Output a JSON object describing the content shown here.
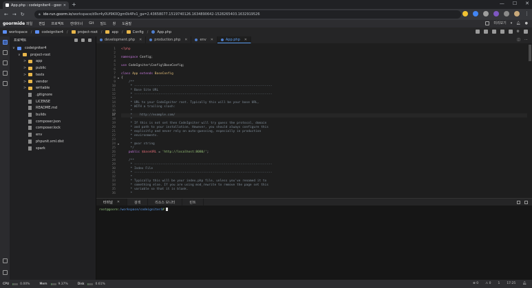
{
  "browser": {
    "tab_title": "App.php : codeigniter4 - goor...",
    "new_tab": "+",
    "url_host": "ide-run.goorm.io",
    "url_path": "/workspace/d9vr4y0Uf9K0Qgm0k4Px1_ga=2.43658077.1519740126.1634890642-1528265403.1632919526",
    "win_min": "—",
    "win_max": "☐",
    "win_close": "✕"
  },
  "ide": {
    "logo": "goormide",
    "menu": [
      "파일",
      "편집",
      "프로젝트",
      "컨테이너",
      "Git",
      "빌드",
      "창",
      "도움말"
    ],
    "menu_right_label": "미리보기"
  },
  "breadcrumb": [
    "workspace",
    "codeigniter4",
    "project-root",
    "app",
    "Config",
    "App.php"
  ],
  "explorer": {
    "title": "프로젝트",
    "tree": [
      {
        "label": "codeigniter4",
        "type": "root",
        "depth": 0,
        "chev": "∨"
      },
      {
        "label": "project-root",
        "type": "folder",
        "depth": 1,
        "chev": "∨"
      },
      {
        "label": "app",
        "type": "folder",
        "depth": 2,
        "chev": ">"
      },
      {
        "label": "public",
        "type": "folder",
        "depth": 2,
        "chev": ">"
      },
      {
        "label": "tests",
        "type": "folder",
        "depth": 2,
        "chev": ">"
      },
      {
        "label": "vendor",
        "type": "folder",
        "depth": 2,
        "chev": ">"
      },
      {
        "label": "writable",
        "type": "folder",
        "depth": 2,
        "chev": ">"
      },
      {
        "label": ".gitignore",
        "type": "file",
        "depth": 2,
        "chev": ""
      },
      {
        "label": "LICENSE",
        "type": "file",
        "depth": 2,
        "chev": ""
      },
      {
        "label": "README.md",
        "type": "file",
        "depth": 2,
        "chev": ""
      },
      {
        "label": "builds",
        "type": "file",
        "depth": 2,
        "chev": ""
      },
      {
        "label": "composer.json",
        "type": "file",
        "depth": 2,
        "chev": ""
      },
      {
        "label": "composer.lock",
        "type": "file",
        "depth": 2,
        "chev": ""
      },
      {
        "label": "env",
        "type": "file",
        "depth": 2,
        "chev": ""
      },
      {
        "label": "phpunit.xml.dist",
        "type": "file",
        "depth": 2,
        "chev": ""
      },
      {
        "label": "spark",
        "type": "file",
        "depth": 2,
        "chev": ""
      }
    ]
  },
  "editor_tabs": [
    {
      "label": "development.php",
      "active": false
    },
    {
      "label": "production.php",
      "active": false
    },
    {
      "label": "env",
      "active": false
    },
    {
      "label": "App.php",
      "active": true
    }
  ],
  "editor": {
    "current_line": 17,
    "fold_lines": [
      8,
      24
    ],
    "lines": [
      [
        {
          "t": "<?php",
          "c": "c-tag"
        }
      ],
      [],
      [
        {
          "t": "namespace ",
          "c": "c-kw"
        },
        {
          "t": "Config;",
          "c": ""
        }
      ],
      [],
      [
        {
          "t": "use ",
          "c": "c-kw"
        },
        {
          "t": "CodeIgniter\\Config\\BaseConfig;",
          "c": ""
        }
      ],
      [],
      [
        {
          "t": "class ",
          "c": "c-kw"
        },
        {
          "t": "App ",
          "c": "c-cls"
        },
        {
          "t": "extends ",
          "c": "c-kw"
        },
        {
          "t": "BaseConfig",
          "c": "c-cls"
        }
      ],
      [
        {
          "t": "{",
          "c": ""
        }
      ],
      [
        {
          "t": "    /**",
          "c": "c-cm"
        }
      ],
      [
        {
          "t": "     * --------------------------------------------------------------------------",
          "c": "c-cm"
        }
      ],
      [
        {
          "t": "     * Base Site URL",
          "c": "c-cm"
        }
      ],
      [
        {
          "t": "     * --------------------------------------------------------------------------",
          "c": "c-cm"
        }
      ],
      [
        {
          "t": "     *",
          "c": "c-cm"
        }
      ],
      [
        {
          "t": "     * URL to your CodeIgniter root. Typically this will be your base URL,",
          "c": "c-cm"
        }
      ],
      [
        {
          "t": "     * WITH a trailing slash:",
          "c": "c-cm"
        }
      ],
      [
        {
          "t": "     *",
          "c": "c-cm"
        }
      ],
      [
        {
          "t": "     *    http://example.com/",
          "c": "c-cm"
        }
      ],
      [
        {
          "t": "     *",
          "c": "c-cm"
        }
      ],
      [
        {
          "t": "     * If this is not set then CodeIgniter will try guess the protocol, domain",
          "c": "c-cm"
        }
      ],
      [
        {
          "t": "     * and path to your installation. However, you should always configure this",
          "c": "c-cm"
        }
      ],
      [
        {
          "t": "     * explicitly and never rely on auto-guessing, especially in production",
          "c": "c-cm"
        }
      ],
      [
        {
          "t": "     * environments.",
          "c": "c-cm"
        }
      ],
      [
        {
          "t": "     *",
          "c": "c-cm"
        }
      ],
      [
        {
          "t": "     * @var string",
          "c": "c-cm"
        }
      ],
      [
        {
          "t": "     */",
          "c": "c-cm"
        }
      ],
      [
        {
          "t": "    public ",
          "c": "c-kw"
        },
        {
          "t": "$baseURL",
          "c": "c-var"
        },
        {
          "t": " = ",
          "c": ""
        },
        {
          "t": "'http://localhost:8080/'",
          "c": "c-str"
        },
        {
          "t": ";",
          "c": ""
        }
      ],
      [],
      [
        {
          "t": "    /**",
          "c": "c-cm"
        }
      ],
      [
        {
          "t": "     * --------------------------------------------------------------------------",
          "c": "c-cm"
        }
      ],
      [
        {
          "t": "     * Index File",
          "c": "c-cm"
        }
      ],
      [
        {
          "t": "     * --------------------------------------------------------------------------",
          "c": "c-cm"
        }
      ],
      [
        {
          "t": "     *",
          "c": "c-cm"
        }
      ],
      [
        {
          "t": "     * Typically this will be your index.php file, unless you've renamed it to",
          "c": "c-cm"
        }
      ],
      [
        {
          "t": "     * something else. If you are using mod_rewrite to remove the page set this",
          "c": "c-cm"
        }
      ],
      [
        {
          "t": "     * variable so that it is blank.",
          "c": "c-cm"
        }
      ],
      [
        {
          "t": "     *",
          "c": "c-cm"
        }
      ]
    ]
  },
  "panel_tabs": [
    {
      "label": "터미널",
      "active": true
    },
    {
      "label": "검색",
      "active": false
    },
    {
      "label": "리소스 모니터",
      "active": false
    },
    {
      "label": "린트",
      "active": false
    }
  ],
  "terminal": {
    "prompt_user": "root@goorm:",
    "prompt_path": "/workspace/codeigniter4",
    "prompt_end": "#"
  },
  "status": {
    "cpu_label": "CPU",
    "cpu_value": "0.00%",
    "cpu_fraction": 0.0,
    "mem_label": "Mem",
    "mem_value": "9.37%",
    "mem_fraction": 0.0937,
    "disk_label": "Disk",
    "disk_value": "0.61%",
    "disk_fraction": 0.0061,
    "errors": "0",
    "warnings": "0",
    "line": "1",
    "col": "1",
    "position": "17:25"
  }
}
